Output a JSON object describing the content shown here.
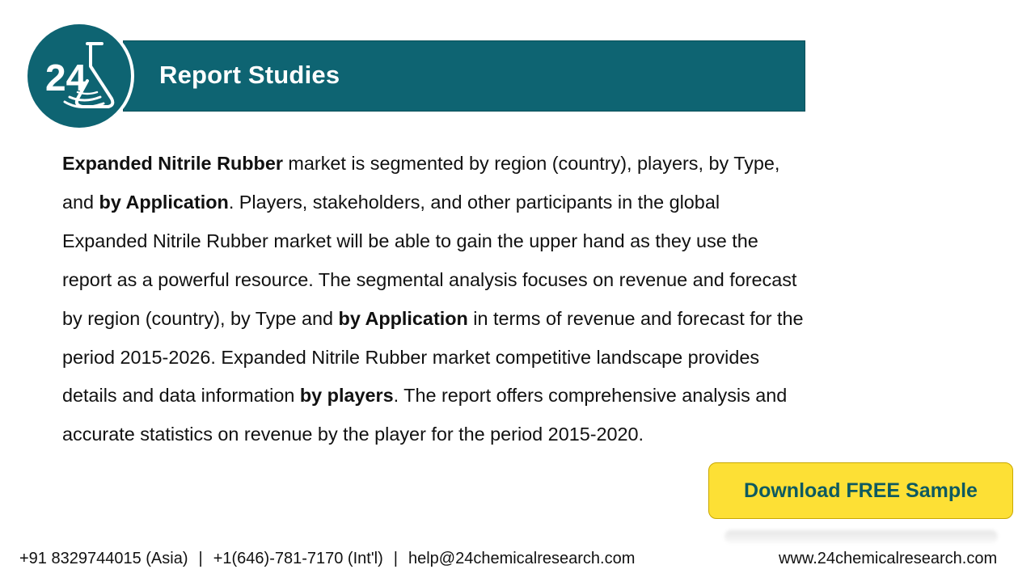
{
  "header": {
    "title": "Report Studies"
  },
  "logo": {
    "text": "24",
    "icon": "flask-icon",
    "bg_color": "#0e6472"
  },
  "body": {
    "segments": [
      {
        "text": "Expanded Nitrile Rubber",
        "bold": true
      },
      {
        "text": " market is segmented by region (country), players, by Type, and ",
        "bold": false
      },
      {
        "text": "by Application",
        "bold": true
      },
      {
        "text": ". Players, stakeholders, and other participants in the global Expanded Nitrile Rubber market will be able to gain the upper hand as they use the report as a powerful resource. The segmental analysis focuses on revenue and forecast by region (country), by Type and ",
        "bold": false
      },
      {
        "text": "by Application",
        "bold": true
      },
      {
        "text": " in terms of revenue and forecast for the period 2015-2026. Expanded Nitrile Rubber market competitive landscape provides details and data information ",
        "bold": false
      },
      {
        "text": "by players",
        "bold": true
      },
      {
        "text": ". The report offers comprehensive analysis and accurate statistics on revenue by the player for the period 2015-2020.",
        "bold": false
      }
    ]
  },
  "cta": {
    "label": "Download FREE Sample",
    "bg_color": "#fde035",
    "text_color": "#0e5a60"
  },
  "footer": {
    "phone_asia": "+91 8329744015 (Asia)",
    "separator": "|",
    "phone_intl": "+1(646)-781-7170 (Int'l)",
    "email": "help@24chemicalresearch.com",
    "website": "www.24chemicalresearch.com"
  }
}
